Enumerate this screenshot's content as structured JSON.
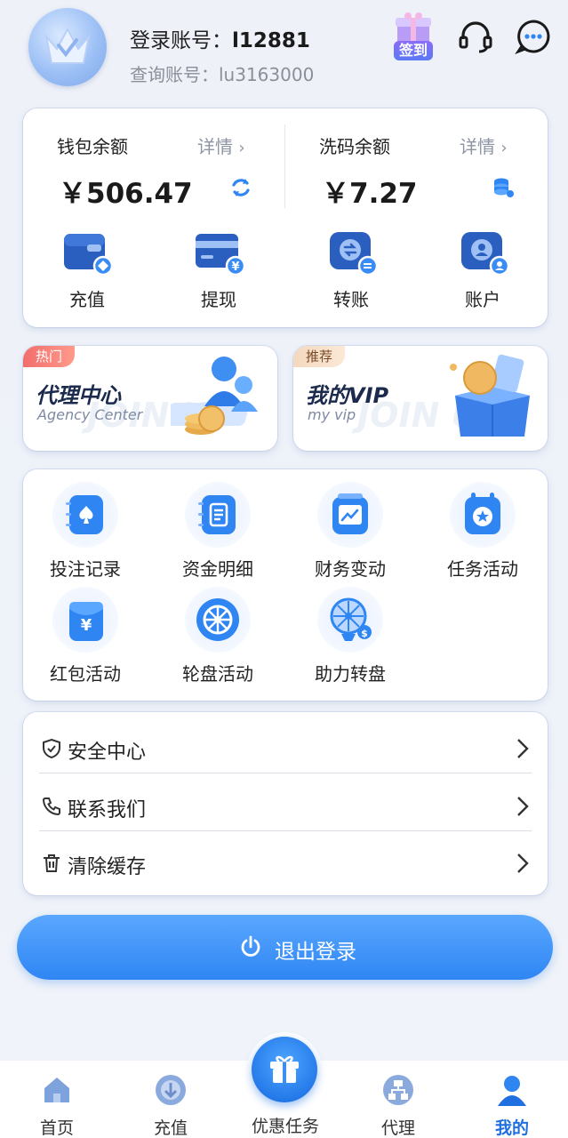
{
  "header": {
    "login_label": "登录账号：",
    "login_account": "l12881",
    "query_label": "查询账号：",
    "query_account": "lu3163000",
    "checkin_label": "签到"
  },
  "wallet": {
    "left": {
      "label": "钱包余额",
      "detail": "详情",
      "amount": "￥506.47"
    },
    "right": {
      "label": "洗码余额",
      "detail": "详情",
      "amount": "￥7.27"
    },
    "actions": [
      {
        "label": "充值"
      },
      {
        "label": "提现"
      },
      {
        "label": "转账"
      },
      {
        "label": "账户"
      }
    ]
  },
  "promos": [
    {
      "tag": "热门",
      "title": "代理中心",
      "subtitle": "Agency Center",
      "watermark": "JOIN US"
    },
    {
      "tag": "推荐",
      "title": "我的VIP",
      "subtitle": "my vip",
      "watermark": "JOIN US"
    }
  ],
  "grid": [
    {
      "label": "投注记录"
    },
    {
      "label": "资金明细"
    },
    {
      "label": "财务变动"
    },
    {
      "label": "任务活动"
    },
    {
      "label": "红包活动"
    },
    {
      "label": "轮盘活动"
    },
    {
      "label": "助力转盘"
    }
  ],
  "menu": [
    {
      "label": "安全中心"
    },
    {
      "label": "联系我们"
    },
    {
      "label": "清除缓存"
    }
  ],
  "logout_label": "退出登录",
  "tabbar": [
    {
      "label": "首页"
    },
    {
      "label": "充值"
    },
    {
      "label": "优惠任务"
    },
    {
      "label": "代理"
    },
    {
      "label": "我的"
    }
  ],
  "colors": {
    "accent": "#2f86f3",
    "active_tab": "#1f6fe0"
  }
}
